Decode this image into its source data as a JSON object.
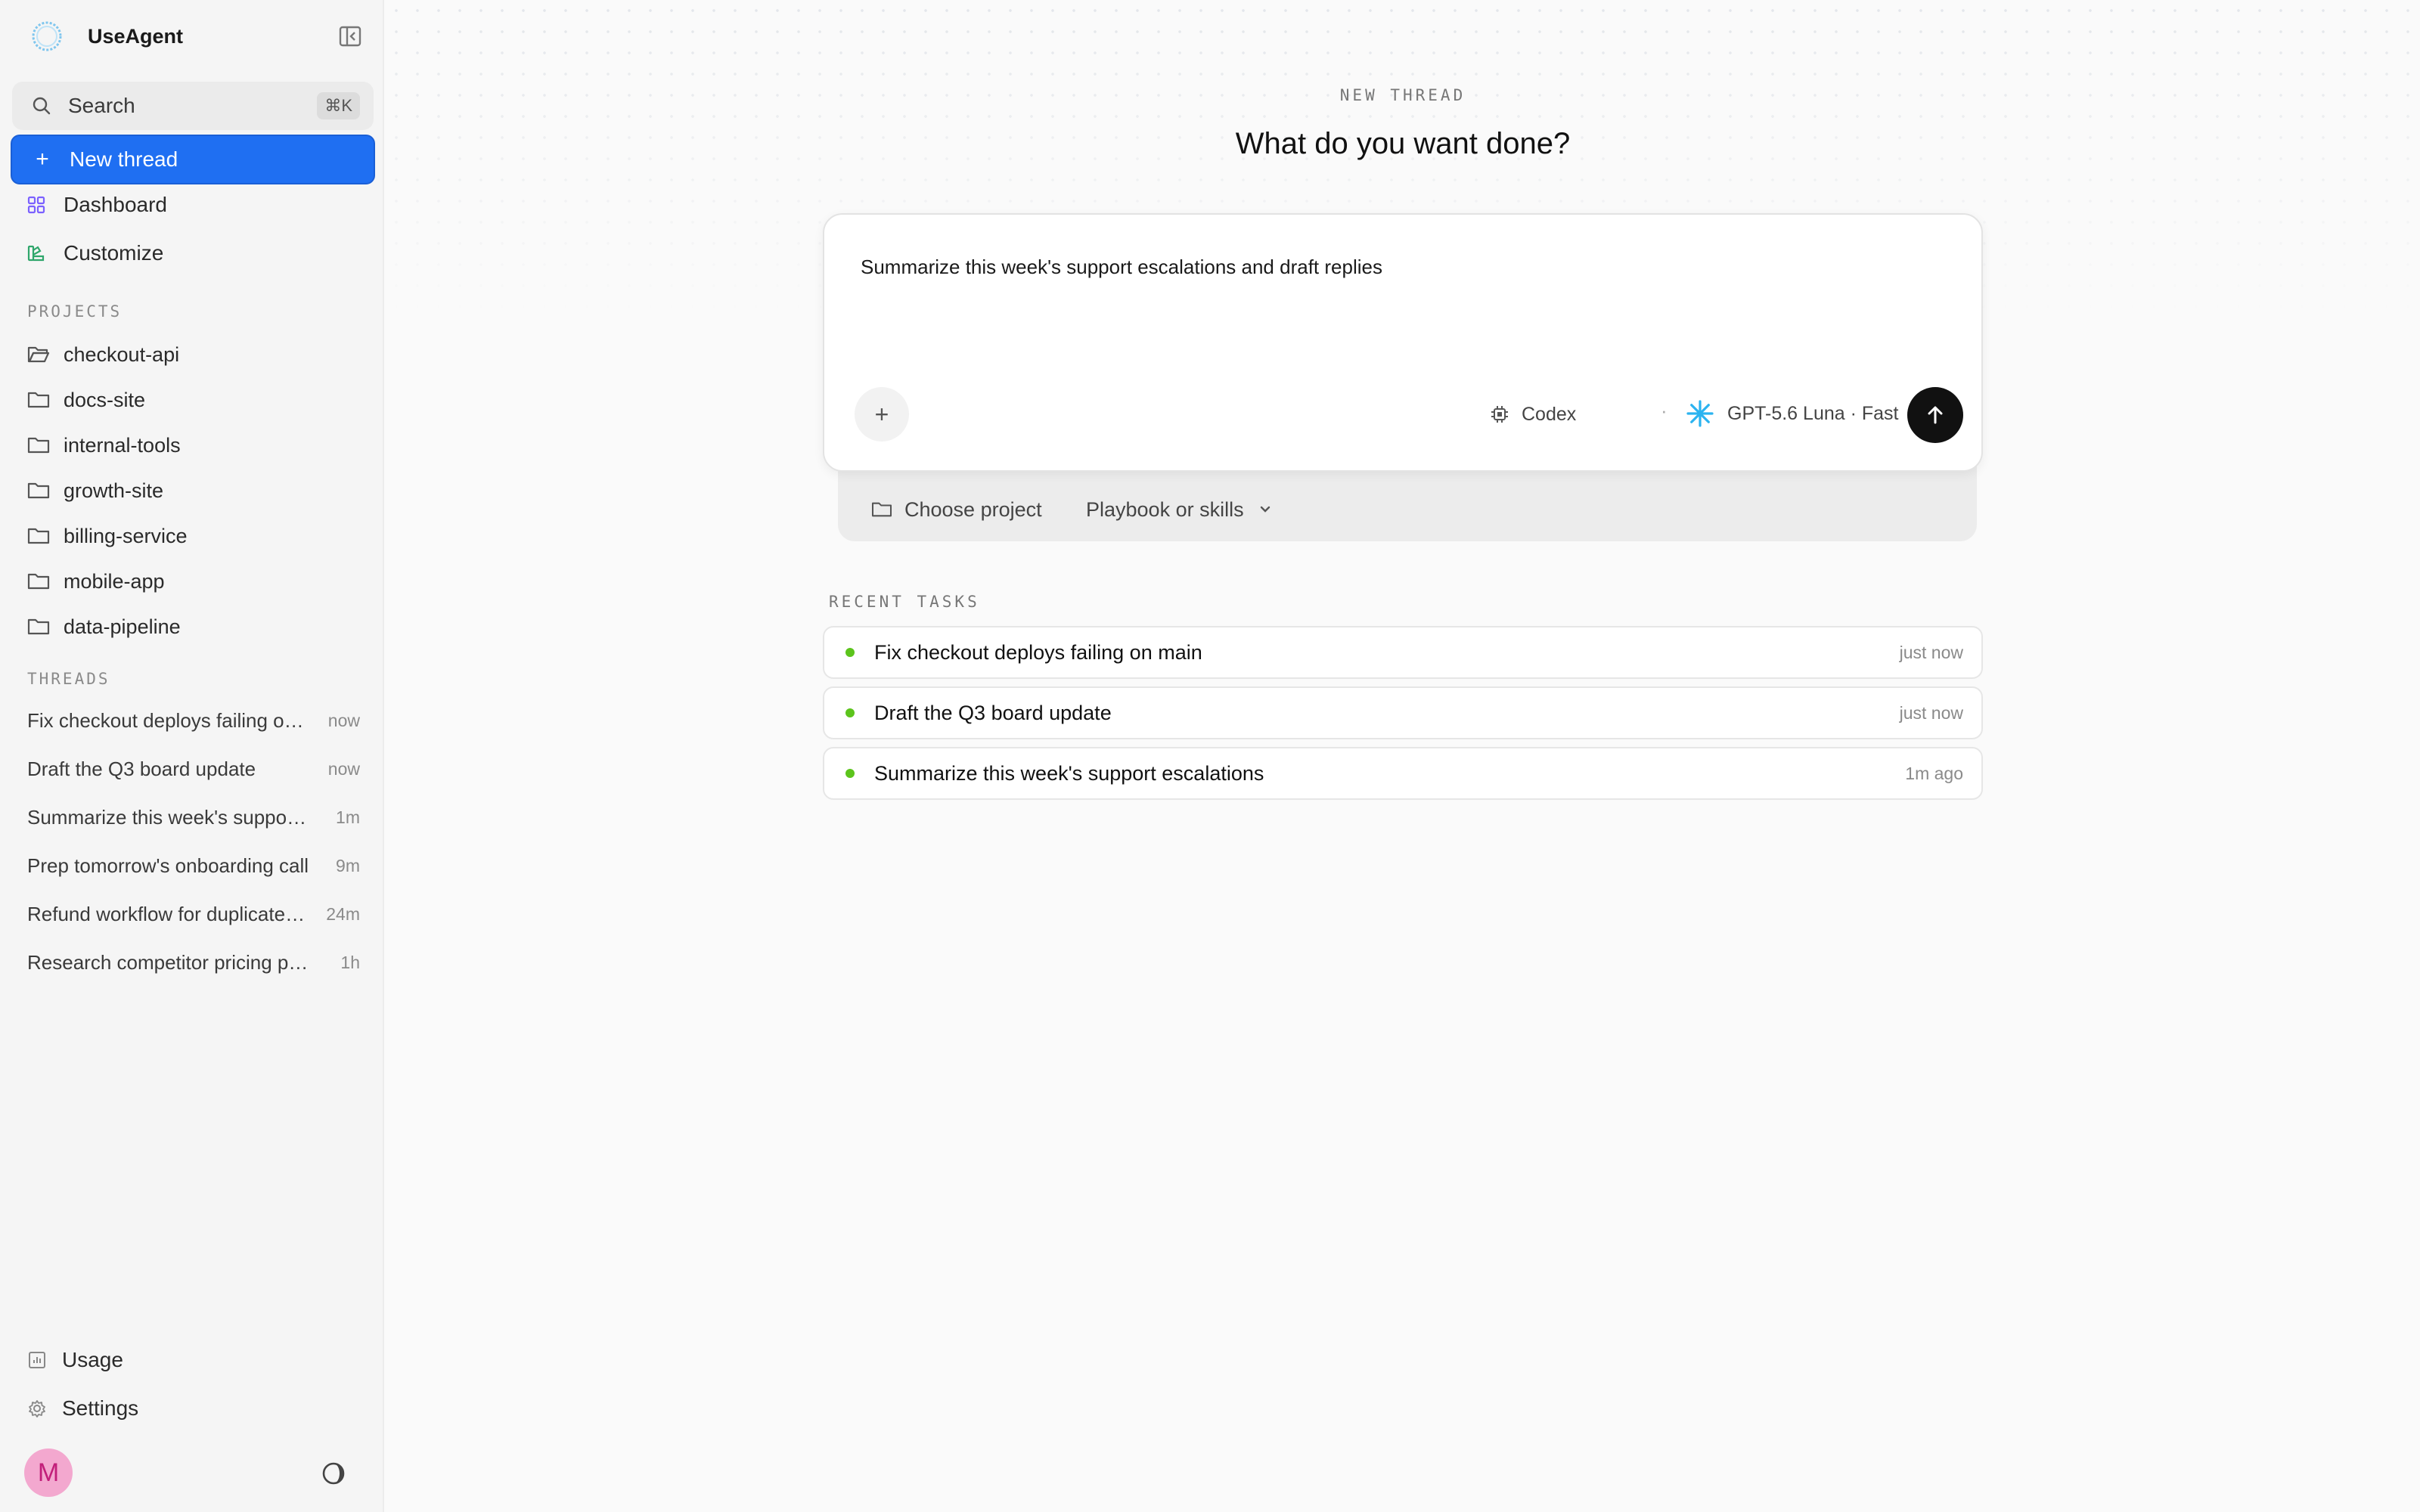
{
  "app": {
    "name": "UseAgent"
  },
  "sidebar": {
    "search": {
      "label": "Search",
      "shortcut": "⌘K"
    },
    "new_thread": {
      "label": "New thread"
    },
    "nav": [
      {
        "label": "Dashboard",
        "icon": "grid-icon",
        "color": "#7b61ff"
      },
      {
        "label": "Customize",
        "icon": "palette-icon",
        "color": "#2fa66b"
      }
    ],
    "projects_label": "PROJECTS",
    "projects": [
      {
        "label": "checkout-api",
        "icon": "folder-open-icon"
      },
      {
        "label": "docs-site",
        "icon": "folder-icon"
      },
      {
        "label": "internal-tools",
        "icon": "folder-icon"
      },
      {
        "label": "growth-site",
        "icon": "folder-icon"
      },
      {
        "label": "billing-service",
        "icon": "folder-icon"
      },
      {
        "label": "mobile-app",
        "icon": "folder-icon"
      },
      {
        "label": "data-pipeline",
        "icon": "folder-icon"
      }
    ],
    "threads_label": "THREADS",
    "threads": [
      {
        "label": "Fix checkout deploys failing on main",
        "time": "now"
      },
      {
        "label": "Draft the Q3 board update",
        "time": "now"
      },
      {
        "label": "Summarize this week's support escalations",
        "time": "1m"
      },
      {
        "label": "Prep tomorrow's onboarding call",
        "time": "9m"
      },
      {
        "label": "Refund workflow for duplicate charges",
        "time": "24m"
      },
      {
        "label": "Research competitor pricing pages",
        "time": "1h"
      }
    ],
    "bottom": [
      {
        "label": "Usage",
        "icon": "chart-icon"
      },
      {
        "label": "Settings",
        "icon": "gear-icon"
      }
    ],
    "avatar_initial": "M"
  },
  "main": {
    "eyebrow": "NEW THREAD",
    "headline": "What do you want done?",
    "composer": {
      "prompt": "Summarize this week's support escalations and draft replies",
      "agent": "Codex",
      "separator": "·",
      "model": "GPT-5.6 Luna · Fast",
      "attach_symbol": "+"
    },
    "tray": {
      "project": "Choose project",
      "skills": "Playbook or skills"
    },
    "recent_label": "RECENT TASKS",
    "recent_tasks": [
      {
        "label": "Fix checkout deploys failing on main",
        "time": "just now"
      },
      {
        "label": "Draft the Q3 board update",
        "time": "just now"
      },
      {
        "label": "Summarize this week's support escalations",
        "time": "1m ago"
      }
    ]
  },
  "colors": {
    "accent": "#1f6ff2",
    "status_dot": "#5cc41c",
    "avatar_bg": "#f3a8cf",
    "model_icon": "#2bb3f0"
  }
}
